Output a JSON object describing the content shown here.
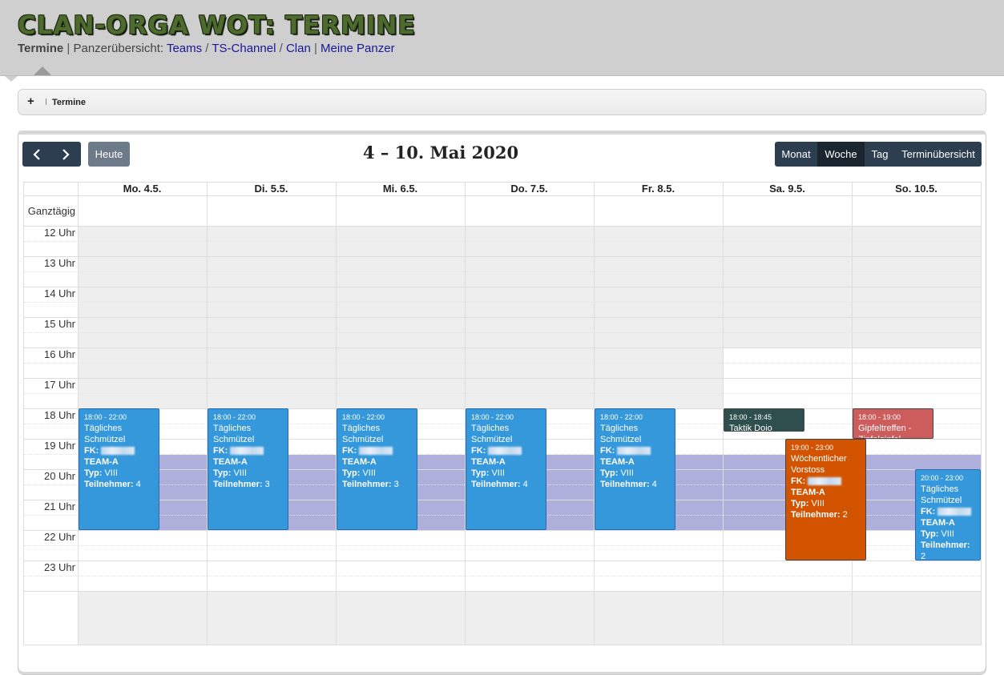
{
  "site": {
    "title": "CLAN-ORGA WOT: TERMINE",
    "nav_current": "Termine",
    "nav_sep1": " | ",
    "nav_prefix": "Panzerübersicht: ",
    "nav_teams": "Teams",
    "nav_slash1": " / ",
    "nav_ts": "TS-Channel",
    "nav_slash2": " / ",
    "nav_clan": "Clan",
    "nav_sep2": " | ",
    "nav_meine": "Meine Panzer"
  },
  "breadcrumb": {
    "plus_icon": "+",
    "label": "Termine"
  },
  "toolbar": {
    "today_label": "Heute",
    "title": "4 – 10. Mai 2020",
    "views": [
      "Monat",
      "Woche",
      "Tag",
      "Terminübersicht"
    ],
    "active_view": "Woche"
  },
  "calendar": {
    "days": [
      "Mo. 4.5.",
      "Di. 5.5.",
      "Mi. 6.5.",
      "Do. 7.5.",
      "Fr. 8.5.",
      "Sa. 9.5.",
      "So. 10.5."
    ],
    "allday_label": "Ganztägig",
    "hours": [
      "12 Uhr",
      "13 Uhr",
      "14 Uhr",
      "15 Uhr",
      "16 Uhr",
      "17 Uhr",
      "18 Uhr",
      "19 Uhr",
      "20 Uhr",
      "21 Uhr",
      "22 Uhr",
      "23 Uhr"
    ],
    "colors": {
      "blue": "#3498db",
      "dark": "#2f4f4f",
      "red": "#cd5c5c",
      "orange": "#d35400",
      "band": "#a9a9d9"
    },
    "events": [
      {
        "day": 0,
        "time": "18:00 - 22:00",
        "title": "Tägliches Schmützel",
        "fk_label": "FK:",
        "team": "TEAM-A",
        "typ_label": "Typ:",
        "typ": "VIII",
        "tn_label": "Teilnehmer:",
        "tn": "4",
        "color": "blue"
      },
      {
        "day": 1,
        "time": "18:00 - 22:00",
        "title": "Tägliches Schmützel",
        "fk_label": "FK:",
        "team": "TEAM-A",
        "typ_label": "Typ:",
        "typ": "VIII",
        "tn_label": "Teilnehmer:",
        "tn": "3",
        "color": "blue"
      },
      {
        "day": 2,
        "time": "18:00 - 22:00",
        "title": "Tägliches Schmützel",
        "fk_label": "FK:",
        "team": "TEAM-A",
        "typ_label": "Typ:",
        "typ": "VIII",
        "tn_label": "Teilnehmer:",
        "tn": "3",
        "color": "blue"
      },
      {
        "day": 3,
        "time": "18:00 - 22:00",
        "title": "Tägliches Schmützel",
        "fk_label": "FK:",
        "team": "TEAM-A",
        "typ_label": "Typ:",
        "typ": "VIII",
        "tn_label": "Teilnehmer:",
        "tn": "4",
        "color": "blue"
      },
      {
        "day": 4,
        "time": "18:00 - 22:00",
        "title": "Tägliches Schmützel",
        "fk_label": "FK:",
        "team": "TEAM-A",
        "typ_label": "Typ:",
        "typ": "VIII",
        "tn_label": "Teilnehmer:",
        "tn": "4",
        "color": "blue"
      },
      {
        "day": 5,
        "time": "18:00 - 18:45",
        "title": "Taktik Dojo",
        "color": "dark"
      },
      {
        "day": 5,
        "time": "19:00 - 23:00",
        "title": "Wöchentlicher Vorstoss",
        "fk_label": "FK:",
        "team": "TEAM-A",
        "typ_label": "Typ:",
        "typ": "VIII",
        "tn_label": "Teilnehmer:",
        "tn": "2",
        "color": "orange"
      },
      {
        "day": 6,
        "time": "18:00 - 19:00",
        "title": "Gipfeltreffen - Zipfelgipfel",
        "color": "red"
      },
      {
        "day": 6,
        "time": "20:00 - 23:00",
        "title": "Tägliches Schmützel",
        "fk_label": "FK:",
        "team": "TEAM-A",
        "typ_label": "Typ:",
        "typ": "VIII",
        "tn_label": "Teilnehmer:",
        "tn": "2",
        "color": "blue"
      }
    ]
  }
}
